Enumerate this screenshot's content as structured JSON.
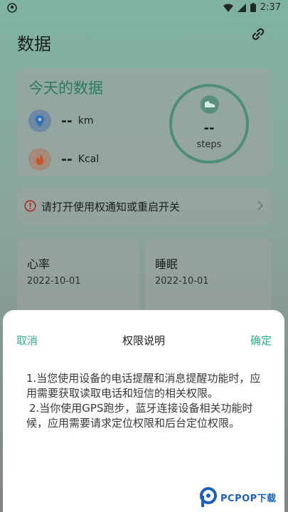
{
  "status_bar": {
    "time": "2:37"
  },
  "header": {
    "title": "数据"
  },
  "today": {
    "title": "今天的数据",
    "distance_value": "--",
    "distance_unit": "km",
    "calories_value": "--",
    "calories_unit": "Kcal",
    "steps_value": "--",
    "steps_unit": "steps"
  },
  "notice": {
    "text": "请打开使用权通知或重启开关"
  },
  "heart_rate": {
    "title": "心率",
    "date": "2022-10-01"
  },
  "sleep": {
    "title": "睡眠",
    "date": "2022-10-01"
  },
  "dialog": {
    "cancel_label": "取消",
    "title": "权限说明",
    "confirm_label": "确定",
    "body_line1": "1.当您使用设备的电话提醒和消息提醒功能时，应用需要获取读取电话和短信的相关权限。",
    "body_line2": "2.当你使用GPS跑步，蓝牙连接设备相关功能时候，应用需要请求定位权限和后台定位权限。"
  },
  "watermark": {
    "text": "PCPOP下载"
  },
  "colors": {
    "accent": "#2fae8a",
    "watermark": "#1b5fbf"
  }
}
